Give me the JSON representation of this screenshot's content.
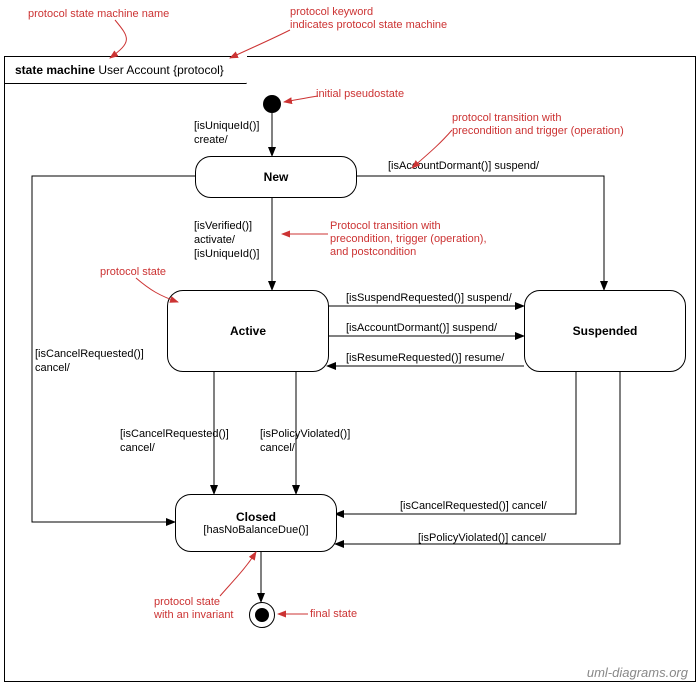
{
  "title_label": "state machine",
  "sm_name": "User Account",
  "sm_keyword": "{protocol}",
  "states": {
    "new": "New",
    "active": "Active",
    "suspended": "Suspended",
    "closed": "Closed",
    "closed_inv": "[hasNoBalanceDue()]"
  },
  "transitions": {
    "init_new": "[isUniqueId()]\ncreate/",
    "new_active": "[isVerified()]\nactivate/\n[isUniqueId()]",
    "new_suspended": "[isAccountDormant()] suspend/",
    "new_closed": "[isCancelRequested()]\ncancel/",
    "active_susp1": "[isSuspendRequested()] suspend/",
    "active_susp2": "[isAccountDormant()] suspend/",
    "susp_active": "[isResumeRequested()] resume/",
    "active_closed1": "[isCancelRequested()]\ncancel/",
    "active_closed2": "[isPolicyViolated()]\ncancel/",
    "susp_closed1": "[isCancelRequested()] cancel/",
    "susp_closed2": "[isPolicyViolated()] cancel/"
  },
  "annotations": {
    "a1": "protocol state machine name",
    "a2": "protocol keyword\nindicates protocol state machine",
    "a3": "initial pseudostate",
    "a4": "protocol transition with\nprecondition and trigger (operation)",
    "a5": "Protocol transition with\nprecondition, trigger (operation),\nand postcondition",
    "a6": "protocol state",
    "a7": "protocol state\nwith an invariant",
    "a8": "final state"
  },
  "watermark": "uml-diagrams.org"
}
